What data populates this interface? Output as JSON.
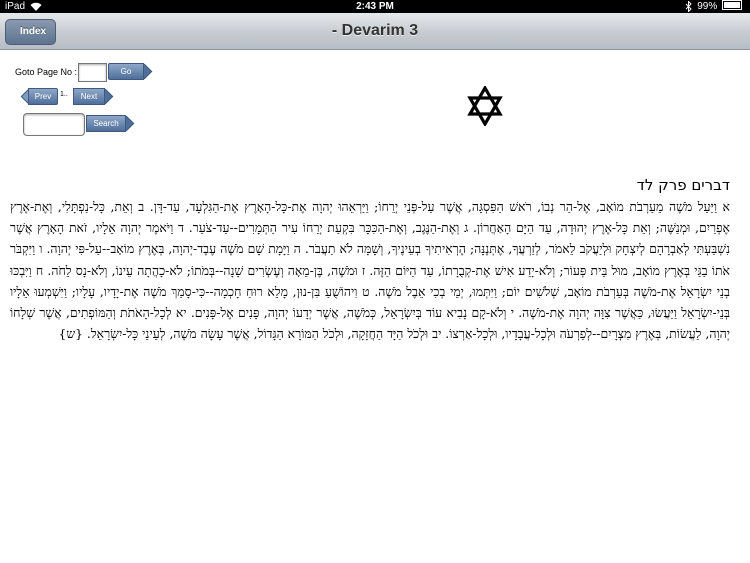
{
  "status_bar": {
    "carrier": "iPad",
    "time": "2:43 PM",
    "battery": "99%"
  },
  "nav": {
    "back_label": "Index",
    "title": "- Devarim  3"
  },
  "controls": {
    "goto_label": "Goto Page No :",
    "goto_value": "",
    "go_label": "Go",
    "prev_label": "Prev",
    "page_indicator": "1..",
    "next_label": "Next",
    "search_value": "",
    "search_label": "Search"
  },
  "icons": {
    "emblem": "star-of-david-icon",
    "wifi": "wifi-icon",
    "bluetooth": "bluetooth-icon",
    "battery": "battery-icon"
  },
  "content": {
    "heading": "דברים פרק לד",
    "text": "א וַיַּעַל מֹשֶׁה מֵעַרְבֹת מוֹאָב, אֶל-הַר נְבוֹ, רֹאשׁ הַפִּסְגָּה, אֲשֶׁר עַל-פְּנֵי יְרֵחוֹ; וַיַּרְאֵהוּ יְהוָה אֶת-כָּל-הָאָרֶץ אֶת-הַגִּלְעָד, עַד-דָּן. ב וְאֵת, כָּל-נַפְתָּלִי, וְאֶת-אֶרֶץ אֶפְרַיִם, וּמְנַשֶּׁה; וְאֵת כָּל-אֶרֶץ יְהוּדָה, עַד הַיָּם הָאַחֲרוֹן. ג וְאֶת-הַנֶּגֶב, וְאֶת-הַכִּכָּר בִּקְעַת יְרֵחוֹ עִיר הַתְּמָרִים--עַד-צֹעַר. ד וַיֹּאמֶר יְהוָה אֵלָיו, זֹאת הָאָרֶץ אֲשֶׁר נִשְׁבַּעְתִּי לְאַבְרָהָם לְיִצְחָק וּלְיַעֲקֹב לֵאמֹר, לְזַרְעֲךָ, אֶתְּנֶנָּה; הֶרְאִיתִיךָ בְעֵינֶיךָ, וְשָׁמָּה לֹא תַעֲבֹר. ה וַיָּמָת שָׁם מֹשֶׁה עֶבֶד-יְהוָה, בְּאֶרֶץ מוֹאָב--עַל-פִּי יְהוָה. ו וַיִּקְבֹּר אֹתוֹ בַגַּי בְּאֶרֶץ מוֹאָב, מוּל בֵּית פְּעוֹר; וְלֹא-יָדַע אִישׁ אֶת-קְבֻרָתוֹ, עַד הַיּוֹם הַזֶּה. ז וּמֹשֶׁה, בֶּן-מֵאָה וְעֶשְׂרִים שָׁנָה--בְּמֹתוֹ; לֹא-כָהֲתָה עֵינוֹ, וְלֹא-נָס לֵחֹה. ח וַיִּבְכּוּ בְנֵי יִשְׂרָאֵל אֶת-מֹשֶׁה בְּעַרְבֹת מוֹאָב, שְׁלֹשִׁים יוֹם; וַיִּתְּמוּ, יְמֵי בְכִי אֵבֶל מֹשֶׁה. ט וִיהוֹשֻׁעַ בִּן-נוּן, מָלֵא רוּחַ חָכְמָה--כִּי-סָמַךְ מֹשֶׁה אֶת-יָדָיו, עָלָיו; וַיִּשְׁמְעוּ אֵלָיו בְּנֵי-יִשְׂרָאֵל וַיַּעֲשׂוּ, כַּאֲשֶׁר צִוָּה יְהוָה אֶת-מֹשֶׁה. י וְלֹא-קָם נָבִיא עוֹד בְּיִשְׂרָאֵל, כְּמֹשֶׁה, אֲשֶׁר יְדָעוֹ יְהוָה, פָּנִים אֶל-פָּנִים. יא לְכָל-הָאֹתֹת וְהַמּוֹפְתִים, אֲשֶׁר שְׁלָחוֹ יְהוָה, לַעֲשׂוֹת, בְּאֶרֶץ מִצְרָיִם--לְפַרְעֹה וּלְכָל-עֲבָדָיו, וּלְכָל-אַרְצוֹ. יב וּלְכֹל הַיָּד הַחֲזָקָה, וּלְכֹל הַמּוֹרָא הַגָּדוֹל, אֲשֶׁר עָשָׂה מֹשֶׁה, לְעֵינֵי כָּל-יִשְׂרָאֵל. {ש}"
  }
}
